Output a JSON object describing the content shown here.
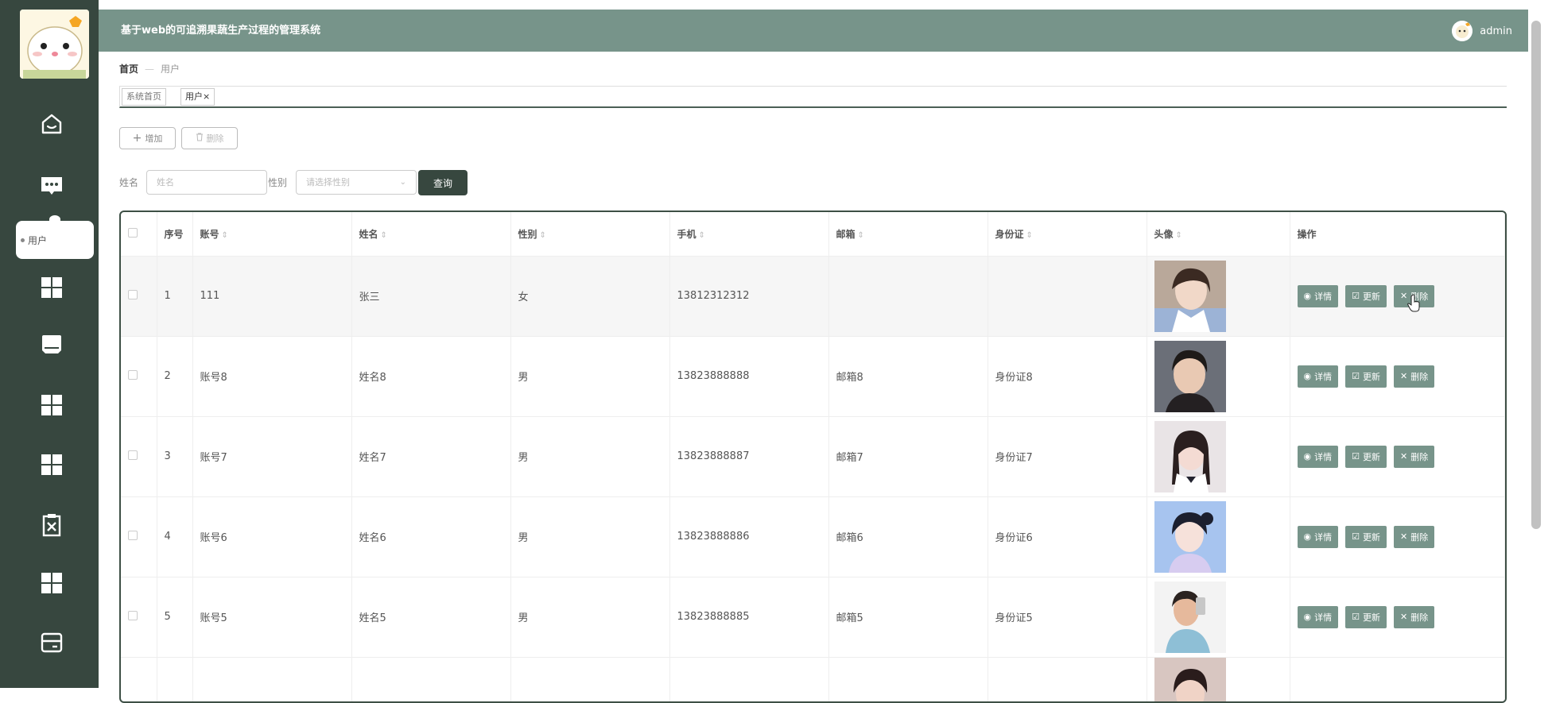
{
  "app": {
    "title": "基于web的可追溯果蔬生产过程的管理系统",
    "user": "admin"
  },
  "sidebar": {
    "submenu_label": "用户"
  },
  "breadcrumb": {
    "home": "首页",
    "sep": "—",
    "current": "用户"
  },
  "tabs": [
    {
      "label": "系统首页"
    },
    {
      "label": "用户×"
    }
  ],
  "toolbar": {
    "add_label": "增加",
    "delete_label": "删除"
  },
  "search": {
    "name_label": "姓名",
    "name_placeholder": "姓名",
    "gender_label": "性别",
    "gender_placeholder": "请选择性别",
    "query_label": "查询"
  },
  "table": {
    "headers": {
      "index": "序号",
      "account": "账号",
      "name": "姓名",
      "gender": "性别",
      "phone": "手机",
      "email": "邮箱",
      "idcard": "身份证",
      "avatar": "头像",
      "actions": "操作"
    },
    "actions": {
      "detail": "详情",
      "update": "更新",
      "delete": "删除"
    },
    "rows": [
      {
        "index": "1",
        "account": "111",
        "name": "张三",
        "gender": "女",
        "phone": "13812312312",
        "email": "",
        "idcard": ""
      },
      {
        "index": "2",
        "account": "账号8",
        "name": "姓名8",
        "gender": "男",
        "phone": "13823888888",
        "email": "邮箱8",
        "idcard": "身份证8"
      },
      {
        "index": "3",
        "account": "账号7",
        "name": "姓名7",
        "gender": "男",
        "phone": "13823888887",
        "email": "邮箱7",
        "idcard": "身份证7"
      },
      {
        "index": "4",
        "account": "账号6",
        "name": "姓名6",
        "gender": "男",
        "phone": "13823888886",
        "email": "邮箱6",
        "idcard": "身份证6"
      },
      {
        "index": "5",
        "account": "账号5",
        "name": "姓名5",
        "gender": "男",
        "phone": "13823888885",
        "email": "邮箱5",
        "idcard": "身份证5"
      },
      {
        "index": "",
        "account": "",
        "name": "",
        "gender": "",
        "phone": "",
        "email": "",
        "idcard": ""
      }
    ]
  },
  "colors": {
    "sidebar": "#37473f",
    "header": "#77948a",
    "accent": "#77948a",
    "dark_button": "#37473f"
  }
}
